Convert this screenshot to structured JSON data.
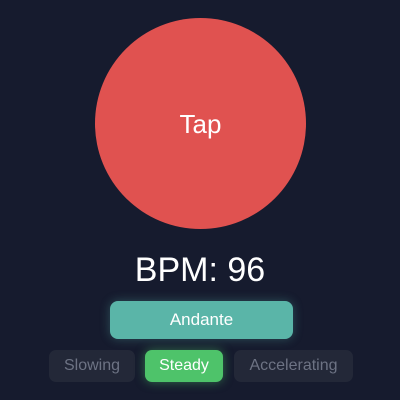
{
  "tap_button": {
    "label": "Tap",
    "color": "#e05250"
  },
  "bpm": {
    "text": "BPM: 96",
    "value": 96
  },
  "tempo_marking": {
    "label": "Andante",
    "color": "#5ab5a8"
  },
  "trend": {
    "options": [
      "Slowing",
      "Steady",
      "Accelerating"
    ],
    "selected": "Steady",
    "active_color": "#4ec36a"
  },
  "colors": {
    "background": "#161b2e",
    "chip_inactive": "#232838"
  }
}
